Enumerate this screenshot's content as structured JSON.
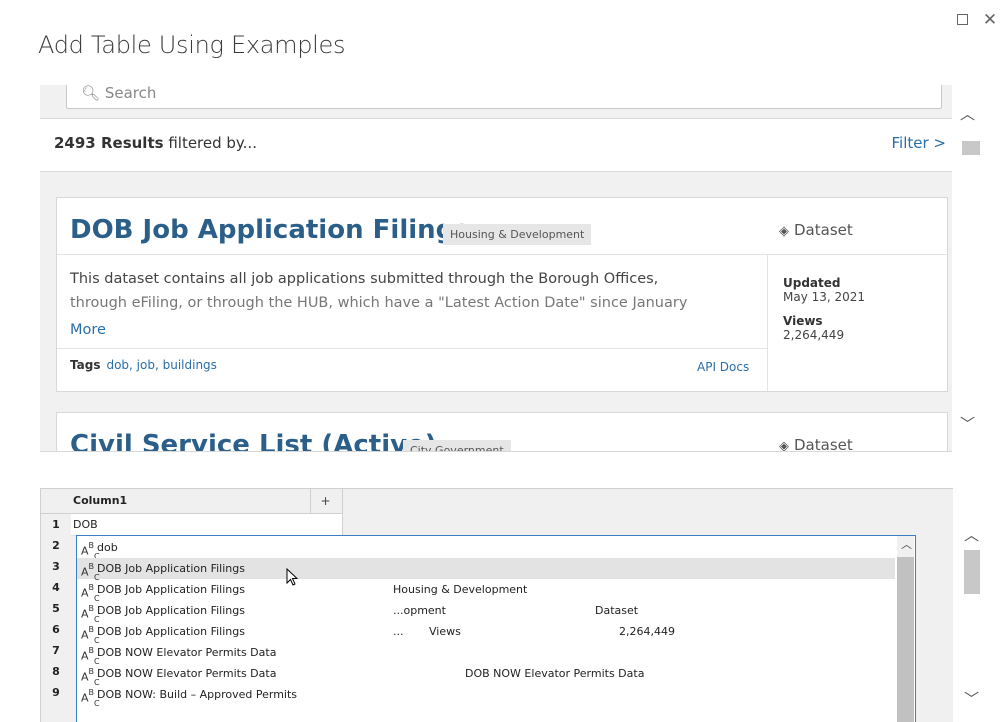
{
  "dialog": {
    "title": "Add Table Using Examples"
  },
  "preview": {
    "search_placeholder": "Search",
    "results_count": "2493 Results",
    "results_suffix": "filtered by...",
    "filter_label": "Filter >",
    "cards": [
      {
        "title": "DOB Job Application Filings",
        "category": "Housing & Development",
        "type": "Dataset",
        "description_line1": "This dataset contains all job applications submitted through the Borough Offices,",
        "description_line2": "through eFiling, or through the HUB, which have a \"Latest Action Date\" since January",
        "more": "More",
        "tags_label": "Tags",
        "tags": "dob, job, buildings",
        "api_docs": "API Docs",
        "updated_label": "Updated",
        "updated_value": "May 13, 2021",
        "views_label": "Views",
        "views_value": "2,264,449"
      },
      {
        "title": "Civil Service List (Active)",
        "category": "City Government",
        "type": "Dataset"
      }
    ]
  },
  "grid": {
    "column_header": "Column1",
    "add_column": "+",
    "row_numbers": [
      "1",
      "2",
      "3",
      "4",
      "5",
      "6",
      "7",
      "8",
      "9"
    ],
    "row1_value": "DOB",
    "suggestions": [
      {
        "text": "dob",
        "c2": "",
        "c3": "",
        "c4": "",
        "c5": "",
        "c6": ""
      },
      {
        "text": "DOB Job Application Filings",
        "c2": "",
        "c3": "",
        "c4": "",
        "c5": "",
        "c6": ""
      },
      {
        "text": "DOB Job Application Filings",
        "c2": "Housing & Development",
        "c3": "",
        "c4": "",
        "c5": "",
        "c6": ""
      },
      {
        "text": "DOB Job Application Filings",
        "c2": "...opment",
        "c3": "",
        "c4": "",
        "c5": "Dataset",
        "c6": ""
      },
      {
        "text": "DOB Job Application Filings",
        "c2": "...",
        "c3": "Views",
        "c4": "",
        "c5": "",
        "c6": "2,264,449"
      },
      {
        "text": "DOB NOW Elevator Permits Data",
        "c2": "",
        "c3": "",
        "c4": "",
        "c5": "",
        "c6": ""
      },
      {
        "text": "DOB NOW Elevator Permits Data",
        "c2": "",
        "c3": "",
        "c4": "DOB NOW Elevator Permits Data",
        "c5": "",
        "c6": ""
      },
      {
        "text": "DOB NOW: Build – Approved Permits",
        "c2": "",
        "c3": "",
        "c4": "",
        "c5": "",
        "c6": ""
      }
    ],
    "abc_icon": {
      "a": "A",
      "b": "B",
      "c": "C"
    }
  }
}
